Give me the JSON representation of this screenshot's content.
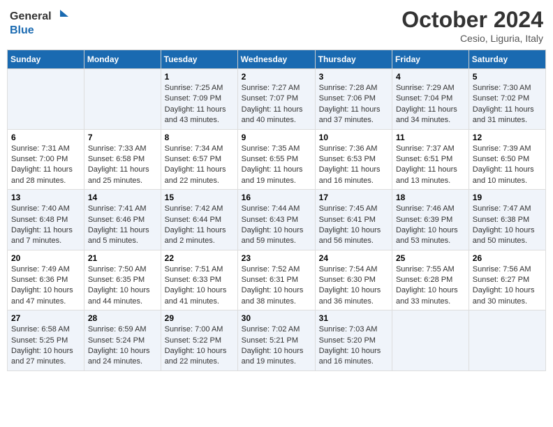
{
  "header": {
    "logo_general": "General",
    "logo_blue": "Blue",
    "title": "October 2024",
    "location": "Cesio, Liguria, Italy"
  },
  "days_of_week": [
    "Sunday",
    "Monday",
    "Tuesday",
    "Wednesday",
    "Thursday",
    "Friday",
    "Saturday"
  ],
  "weeks": [
    {
      "days": [
        {
          "num": "",
          "info": ""
        },
        {
          "num": "",
          "info": ""
        },
        {
          "num": "1",
          "info": "Sunrise: 7:25 AM\nSunset: 7:09 PM\nDaylight: 11 hours and 43 minutes."
        },
        {
          "num": "2",
          "info": "Sunrise: 7:27 AM\nSunset: 7:07 PM\nDaylight: 11 hours and 40 minutes."
        },
        {
          "num": "3",
          "info": "Sunrise: 7:28 AM\nSunset: 7:06 PM\nDaylight: 11 hours and 37 minutes."
        },
        {
          "num": "4",
          "info": "Sunrise: 7:29 AM\nSunset: 7:04 PM\nDaylight: 11 hours and 34 minutes."
        },
        {
          "num": "5",
          "info": "Sunrise: 7:30 AM\nSunset: 7:02 PM\nDaylight: 11 hours and 31 minutes."
        }
      ]
    },
    {
      "days": [
        {
          "num": "6",
          "info": "Sunrise: 7:31 AM\nSunset: 7:00 PM\nDaylight: 11 hours and 28 minutes."
        },
        {
          "num": "7",
          "info": "Sunrise: 7:33 AM\nSunset: 6:58 PM\nDaylight: 11 hours and 25 minutes."
        },
        {
          "num": "8",
          "info": "Sunrise: 7:34 AM\nSunset: 6:57 PM\nDaylight: 11 hours and 22 minutes."
        },
        {
          "num": "9",
          "info": "Sunrise: 7:35 AM\nSunset: 6:55 PM\nDaylight: 11 hours and 19 minutes."
        },
        {
          "num": "10",
          "info": "Sunrise: 7:36 AM\nSunset: 6:53 PM\nDaylight: 11 hours and 16 minutes."
        },
        {
          "num": "11",
          "info": "Sunrise: 7:37 AM\nSunset: 6:51 PM\nDaylight: 11 hours and 13 minutes."
        },
        {
          "num": "12",
          "info": "Sunrise: 7:39 AM\nSunset: 6:50 PM\nDaylight: 11 hours and 10 minutes."
        }
      ]
    },
    {
      "days": [
        {
          "num": "13",
          "info": "Sunrise: 7:40 AM\nSunset: 6:48 PM\nDaylight: 11 hours and 7 minutes."
        },
        {
          "num": "14",
          "info": "Sunrise: 7:41 AM\nSunset: 6:46 PM\nDaylight: 11 hours and 5 minutes."
        },
        {
          "num": "15",
          "info": "Sunrise: 7:42 AM\nSunset: 6:44 PM\nDaylight: 11 hours and 2 minutes."
        },
        {
          "num": "16",
          "info": "Sunrise: 7:44 AM\nSunset: 6:43 PM\nDaylight: 10 hours and 59 minutes."
        },
        {
          "num": "17",
          "info": "Sunrise: 7:45 AM\nSunset: 6:41 PM\nDaylight: 10 hours and 56 minutes."
        },
        {
          "num": "18",
          "info": "Sunrise: 7:46 AM\nSunset: 6:39 PM\nDaylight: 10 hours and 53 minutes."
        },
        {
          "num": "19",
          "info": "Sunrise: 7:47 AM\nSunset: 6:38 PM\nDaylight: 10 hours and 50 minutes."
        }
      ]
    },
    {
      "days": [
        {
          "num": "20",
          "info": "Sunrise: 7:49 AM\nSunset: 6:36 PM\nDaylight: 10 hours and 47 minutes."
        },
        {
          "num": "21",
          "info": "Sunrise: 7:50 AM\nSunset: 6:35 PM\nDaylight: 10 hours and 44 minutes."
        },
        {
          "num": "22",
          "info": "Sunrise: 7:51 AM\nSunset: 6:33 PM\nDaylight: 10 hours and 41 minutes."
        },
        {
          "num": "23",
          "info": "Sunrise: 7:52 AM\nSunset: 6:31 PM\nDaylight: 10 hours and 38 minutes."
        },
        {
          "num": "24",
          "info": "Sunrise: 7:54 AM\nSunset: 6:30 PM\nDaylight: 10 hours and 36 minutes."
        },
        {
          "num": "25",
          "info": "Sunrise: 7:55 AM\nSunset: 6:28 PM\nDaylight: 10 hours and 33 minutes."
        },
        {
          "num": "26",
          "info": "Sunrise: 7:56 AM\nSunset: 6:27 PM\nDaylight: 10 hours and 30 minutes."
        }
      ]
    },
    {
      "days": [
        {
          "num": "27",
          "info": "Sunrise: 6:58 AM\nSunset: 5:25 PM\nDaylight: 10 hours and 27 minutes."
        },
        {
          "num": "28",
          "info": "Sunrise: 6:59 AM\nSunset: 5:24 PM\nDaylight: 10 hours and 24 minutes."
        },
        {
          "num": "29",
          "info": "Sunrise: 7:00 AM\nSunset: 5:22 PM\nDaylight: 10 hours and 22 minutes."
        },
        {
          "num": "30",
          "info": "Sunrise: 7:02 AM\nSunset: 5:21 PM\nDaylight: 10 hours and 19 minutes."
        },
        {
          "num": "31",
          "info": "Sunrise: 7:03 AM\nSunset: 5:20 PM\nDaylight: 10 hours and 16 minutes."
        },
        {
          "num": "",
          "info": ""
        },
        {
          "num": "",
          "info": ""
        }
      ]
    }
  ]
}
